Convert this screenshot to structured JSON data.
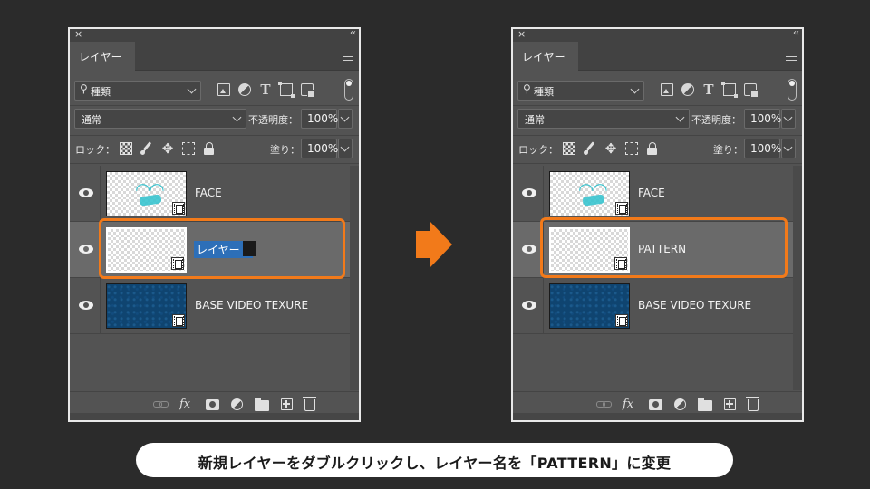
{
  "panel": {
    "tab_label": "レイヤー",
    "close_symbol": "×",
    "collapse_symbol": "‹‹",
    "filter_kind": "種類",
    "blend_mode": "通常",
    "opacity_label": "不透明度：",
    "opacity_value": "100%",
    "lock_label": "ロック：",
    "fill_label": "塗り：",
    "fill_value": "100%",
    "fx_label": "fx"
  },
  "before": {
    "layers": [
      {
        "name": "FACE",
        "thumb": "face",
        "visible": true
      },
      {
        "name": "レイヤー 1",
        "thumb": "transparent",
        "visible": true,
        "selected": true,
        "editing": true
      },
      {
        "name": "BASE VIDEO TEXURE",
        "thumb": "blue",
        "visible": true
      }
    ]
  },
  "after": {
    "layers": [
      {
        "name": "FACE",
        "thumb": "face",
        "visible": true
      },
      {
        "name": "PATTERN",
        "thumb": "transparent",
        "visible": true,
        "selected": true
      },
      {
        "name": "BASE VIDEO TEXURE",
        "thumb": "blue",
        "visible": true
      }
    ]
  },
  "caption": "新規レイヤーをダブルクリックし、レイヤー名を「PATTERN」に変更",
  "colors": {
    "highlight": "#f27a1a",
    "arrow": "#f27a1a",
    "panel_bg": "#535353",
    "selected_row": "#6a6a6a",
    "edit_selection": "#2d6fb8"
  },
  "icons": [
    "close-icon",
    "collapse-icon",
    "panel-menu-icon",
    "search-icon",
    "filter-pixel-icon",
    "filter-adjustment-icon",
    "filter-type-icon",
    "filter-shape-icon",
    "filter-smart-object-icon",
    "filter-toggle",
    "lock-transparency-icon",
    "lock-paint-icon",
    "lock-position-icon",
    "lock-artboard-icon",
    "lock-all-icon",
    "eye-icon",
    "video-layer-icon",
    "link-layers-icon",
    "fx-icon",
    "layer-mask-icon",
    "adjustment-layer-icon",
    "group-folder-icon",
    "new-layer-icon",
    "trash-icon",
    "right-arrow-icon"
  ]
}
